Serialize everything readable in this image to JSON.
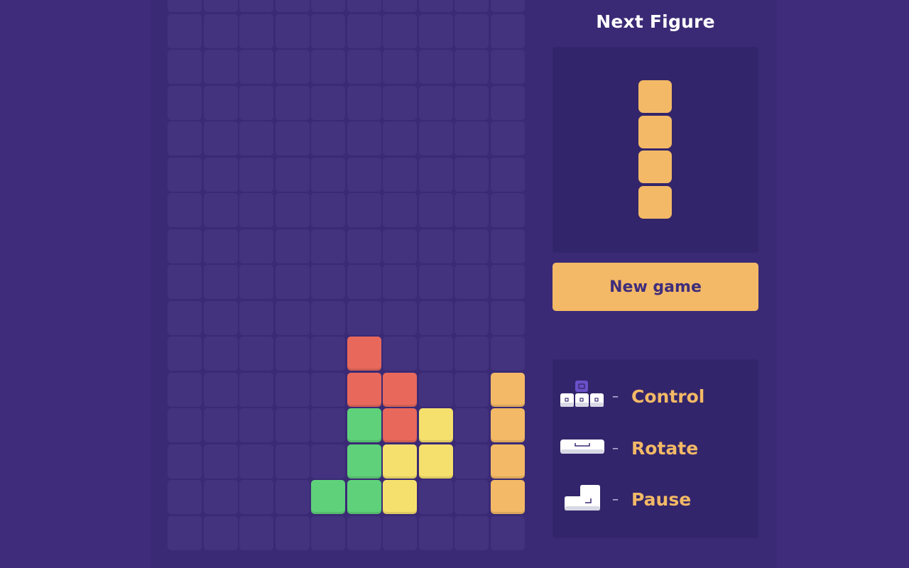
{
  "next_figure": {
    "title": "Next Figure",
    "piece": "I",
    "color": "#f3b966"
  },
  "new_game_label": "New game",
  "controls": [
    {
      "icon": "arrow-keys-icon",
      "dash": "–",
      "label": "Control"
    },
    {
      "icon": "spacebar-icon",
      "dash": "–",
      "label": "Rotate"
    },
    {
      "icon": "enter-key-icon",
      "dash": "–",
      "label": "Pause"
    }
  ],
  "colors": {
    "empty": "#43337f",
    "red": "#e8695c",
    "green": "#5fd17a",
    "yellow": "#f6e06d",
    "orange": "#f3b966"
  },
  "board": {
    "cols": 10,
    "visible_rows": 16,
    "rows_from_top": [
      "..........",
      "..........",
      "..........",
      "..........",
      "..........",
      "..........",
      "..........",
      "..........",
      "..........",
      "..........",
      ".....R....",
      ".....RR..O",
      ".....GRY.O",
      ".....GYY.O",
      "....GGY..O",
      ".........."
    ]
  }
}
